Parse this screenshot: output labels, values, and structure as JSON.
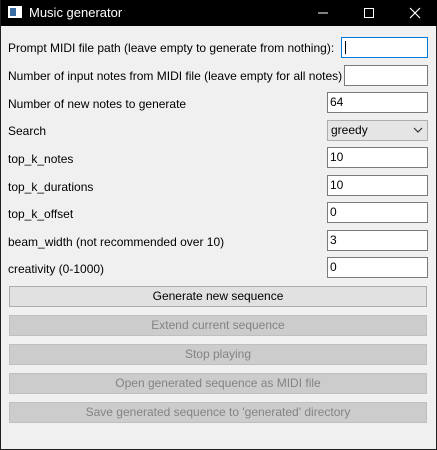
{
  "window": {
    "title": "Music generator",
    "controls": [
      "minimize-icon",
      "maximize-icon",
      "close-icon"
    ]
  },
  "form": {
    "prompt_path": {
      "label": "Prompt MIDI file path (leave empty to generate from nothing):",
      "value": ""
    },
    "input_notes": {
      "label": "Number of input notes from MIDI file (leave empty for all notes)",
      "value": ""
    },
    "new_notes": {
      "label": "Number of new notes to generate",
      "value": "64"
    },
    "search": {
      "label": "Search",
      "selected": "greedy"
    },
    "top_k_notes": {
      "label": "top_k_notes",
      "value": "10"
    },
    "top_k_durations": {
      "label": "top_k_durations",
      "value": "10"
    },
    "top_k_offset": {
      "label": "top_k_offset",
      "value": "0"
    },
    "beam_width": {
      "label": "beam_width (not recommended over 10)",
      "value": "3"
    },
    "creativity": {
      "label": "creativity (0-1000)",
      "value": "0"
    }
  },
  "actions": {
    "generate": "Generate new sequence",
    "extend": "Extend current sequence",
    "stop": "Stop playing",
    "open_midi": "Open generated sequence as MIDI file",
    "save": "Save generated sequence to 'generated' directory"
  },
  "colors": {
    "titlebar": "#000000",
    "window_bg": "#f0f0f0",
    "focus_border": "#0078d7",
    "disabled_text": "#838383"
  }
}
